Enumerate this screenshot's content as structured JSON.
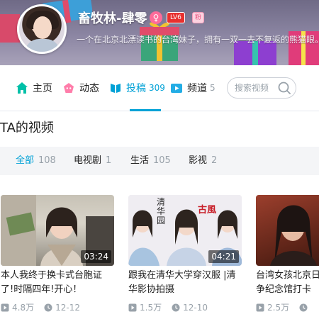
{
  "profile": {
    "username": "畜牧林-肆零",
    "gender_icon": "♀",
    "level_badge": "LV6",
    "fan_badge": "粉",
    "signature": "一个在北京北漂读书的台湾妹子，拥有一双一去不复返的熊猫眼。"
  },
  "nav": {
    "items": [
      {
        "label": "主页",
        "icon": "home-icon",
        "count": ""
      },
      {
        "label": "动态",
        "icon": "activity-icon",
        "count": ""
      },
      {
        "label": "投稿",
        "icon": "upload-icon",
        "count": "309"
      },
      {
        "label": "频道",
        "icon": "channel-icon",
        "count": "5"
      }
    ],
    "active": "投稿",
    "search_placeholder": "搜索视频"
  },
  "section": {
    "title": "TA的视频"
  },
  "filters": [
    {
      "label": "全部",
      "count": "108",
      "active": true
    },
    {
      "label": "电视剧",
      "count": "1",
      "active": false
    },
    {
      "label": "生活",
      "count": "105",
      "active": false
    },
    {
      "label": "影视",
      "count": "2",
      "active": false
    }
  ],
  "videos": [
    {
      "title": "本人我终于换卡式台胞证了!时隔四年!开心！",
      "duration": "03:24",
      "views": "4.8万",
      "date": "12-12"
    },
    {
      "title": "跟我在清华大学穿汉服 |清华影协拍摄",
      "duration": "04:21",
      "views": "1.5万",
      "date": "12-10",
      "thumb_text_left": "清华园",
      "thumb_text_right": "古風"
    },
    {
      "title": "台湾女孩北京日记 抗日战争纪念馆打卡",
      "duration": "",
      "views": "2.5万",
      "date": ""
    }
  ],
  "colors": {
    "accent": "#00a1d6",
    "muted": "#99a2aa",
    "gender": "#ff6b9a",
    "level": "#e8302e"
  }
}
